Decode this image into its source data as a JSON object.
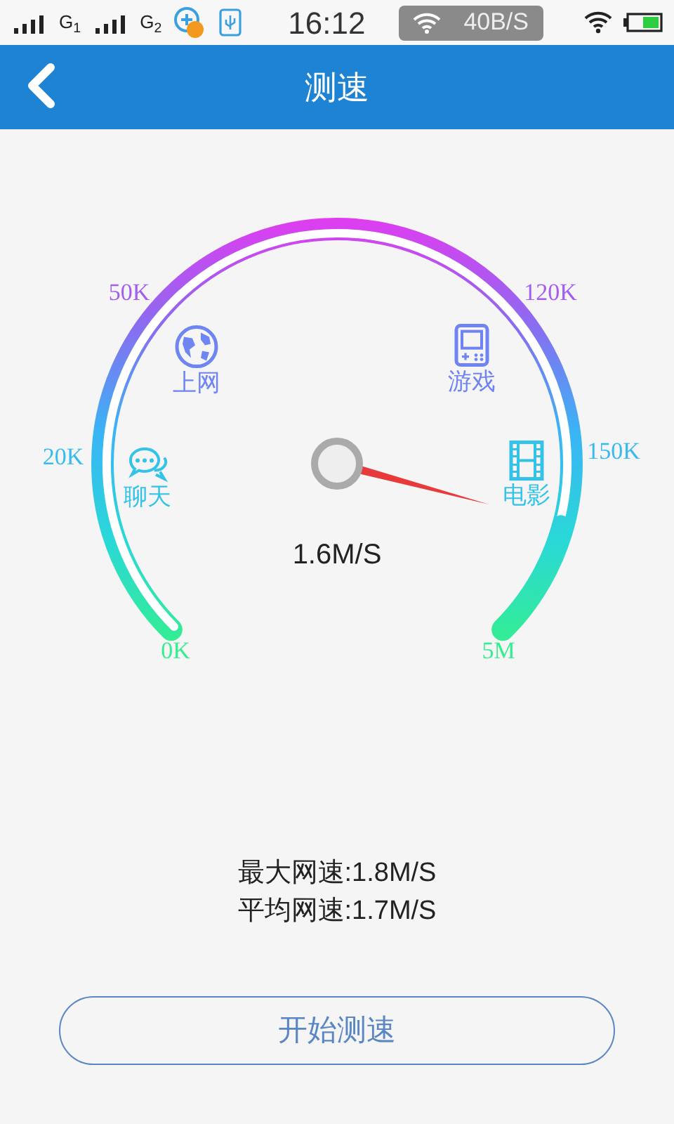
{
  "status_bar": {
    "sim_1": "G$_{1}$",
    "sim_2": "G$_{2}$",
    "time": "16:12",
    "net_speed": "40B/S"
  },
  "header": {
    "title": "测速"
  },
  "gauge": {
    "ticks": [
      "0K",
      "20K",
      "50K",
      "120K",
      "150K",
      "5M"
    ],
    "categories": [
      {
        "kind": "chat",
        "label": "聊天"
      },
      {
        "kind": "web",
        "label": "上网"
      },
      {
        "kind": "game",
        "label": "游戏"
      },
      {
        "kind": "movie",
        "label": "电影"
      }
    ],
    "reading": "1.6M/S"
  },
  "stats": [
    "最大网速:1.8M/S",
    "平均网速:1.7M/S"
  ],
  "start_button": "开始测速"
}
